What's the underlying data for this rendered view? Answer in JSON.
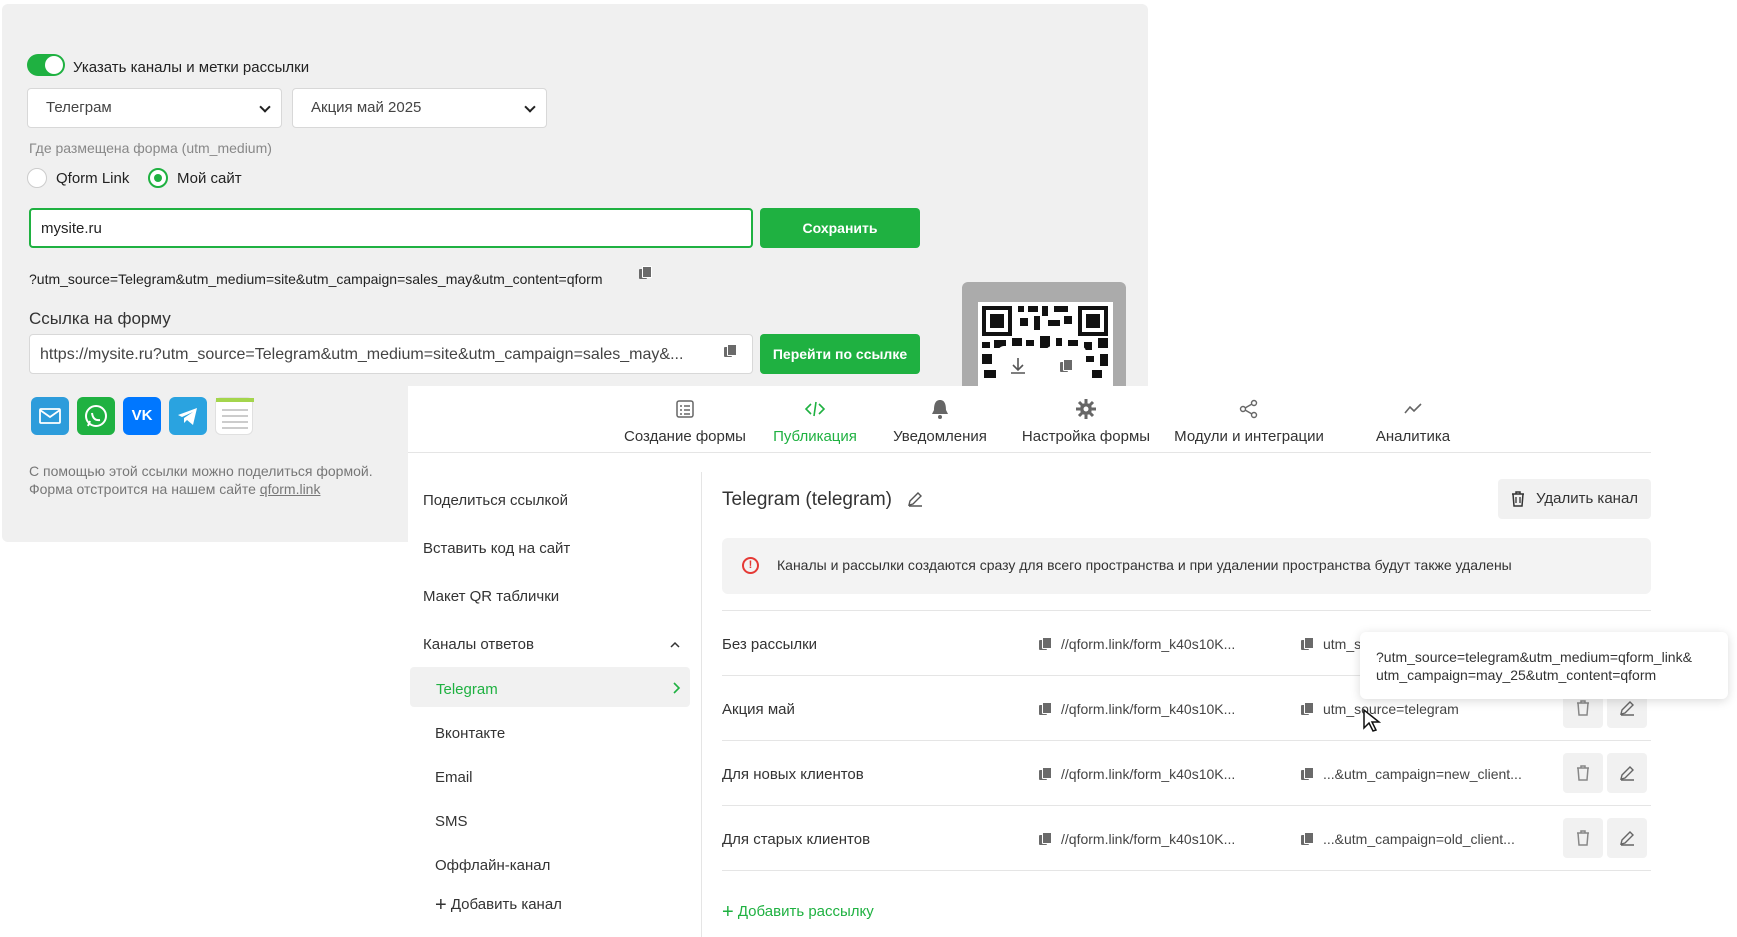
{
  "settings": {
    "toggle_label": "Указать каналы и метки рассылки",
    "channel_select": "Телеграм",
    "campaign_select": "Акция май 2025",
    "utm_medium_label": "Где размещена форма (utm_medium)",
    "radio_qform": "Qform Link",
    "radio_site": "Мой сайт",
    "site_value": "mysite.ru",
    "save_label": "Сохранить",
    "utm_string": "?utm_source=Telegram&utm_medium=site&utm_campaign=sales_may&utm_content=qform",
    "link_title": "Ссылка на форму",
    "link_value": "https://mysite.ru?utm_source=Telegram&utm_medium=site&utm_campaign=sales_may&...",
    "go_label": "Перейти по ссылке",
    "help_line1": "С помощью этой ссылки можно поделиться формой.",
    "help_line2": "Форма отстроится на нашем сайте",
    "help_link": "qform.link"
  },
  "share_icons": [
    "mail-icon",
    "whatsapp-icon",
    "vk-icon",
    "telegram-icon",
    "document-icon"
  ],
  "tabs": [
    {
      "label": "Создание формы",
      "icon": "form-icon"
    },
    {
      "label": "Публикация",
      "icon": "code-icon"
    },
    {
      "label": "Уведомления",
      "icon": "bell-icon"
    },
    {
      "label": "Настройка формы",
      "icon": "gear-icon"
    },
    {
      "label": "Модули и интеграции",
      "icon": "share-nodes-icon"
    },
    {
      "label": "Аналитика",
      "icon": "chart-line-icon"
    }
  ],
  "active_tab": "Публикация",
  "sidebar": {
    "items": [
      "Поделиться ссылкой",
      "Вставить код на сайт",
      "Макет QR таблички",
      "Каналы ответов"
    ],
    "channels": [
      "Telegram",
      "Вконтакте",
      "Email",
      "SMS",
      "Оффлайн-канал"
    ],
    "active_channel": "Telegram",
    "add_channel": "Добавить канал"
  },
  "channel": {
    "title": "Telegram (telegram)",
    "delete_label": "Удалить канал",
    "alert": "Каналы и рассылки создаются сразу для всего пространства и при удалении пространства будут также удалены"
  },
  "mailings": [
    {
      "name": "Без рассылки",
      "link": "//qform.link/form_k40s10K...",
      "utm": "utm_s"
    },
    {
      "name": "Акция май",
      "link": "//qform.link/form_k40s10K...",
      "utm": "utm_source=telegram"
    },
    {
      "name": "Для новых клиентов",
      "link": "//qform.link/form_k40s10K...",
      "utm": "...&utm_campaign=new_client..."
    },
    {
      "name": "Для старых клиентов",
      "link": "//qform.link/form_k40s10K...",
      "utm": "...&utm_campaign=old_client..."
    }
  ],
  "add_mailing": "Добавить рассылку",
  "tooltip": {
    "line1": "?utm_source=telegram&utm_medium=qform_link&",
    "line2": "utm_campaign=may_25&utm_content=qform"
  },
  "colors": {
    "accent": "#1fb141",
    "danger": "#e53935"
  }
}
